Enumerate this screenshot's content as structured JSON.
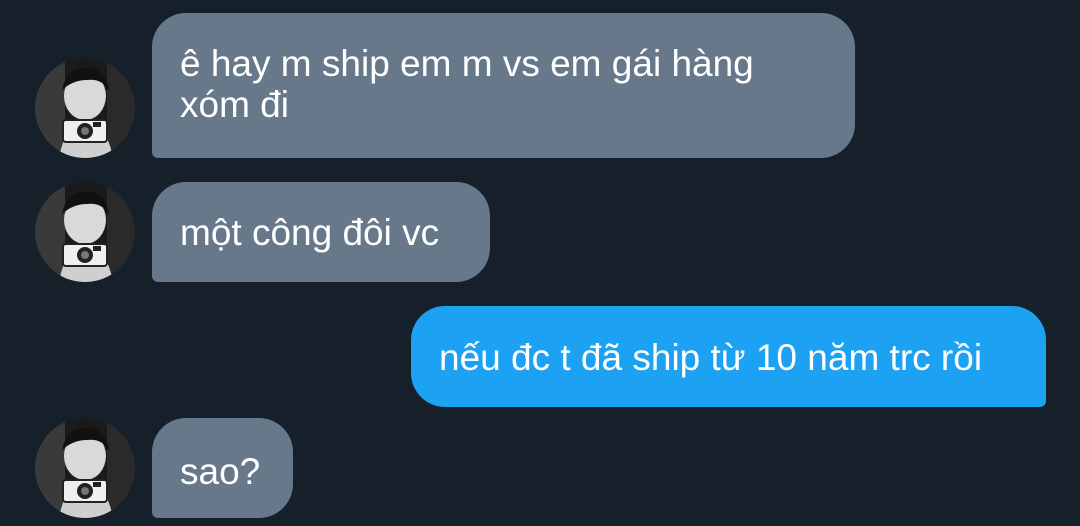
{
  "conversation": {
    "messages": [
      {
        "direction": "incoming",
        "text": "ê hay m ship em m vs em gái hàng xóm đi"
      },
      {
        "direction": "incoming",
        "text": "một công đôi vc"
      },
      {
        "direction": "outgoing",
        "text": "nếu đc t đã ship từ 10 năm trc rồi"
      },
      {
        "direction": "incoming",
        "text": "sao?"
      }
    ]
  },
  "colors": {
    "background": "#15202b",
    "incoming_bubble": "#66788a",
    "outgoing_bubble": "#1da1f2",
    "text": "#ffffff"
  },
  "icons": {
    "avatar": "avatar-photo-person-holding-camera"
  }
}
